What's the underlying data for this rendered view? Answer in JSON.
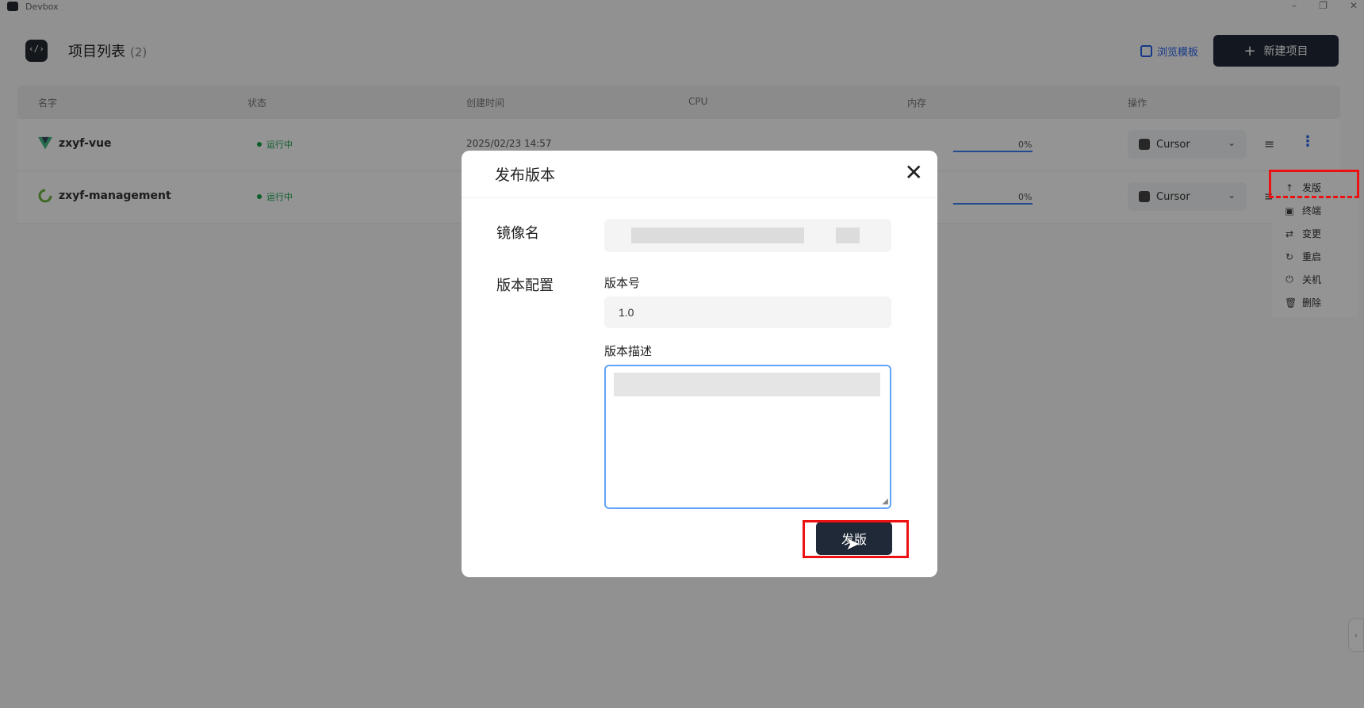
{
  "app": {
    "name": "Devbox"
  },
  "window_controls": [
    "–",
    "❐",
    "✕"
  ],
  "header": {
    "title": "项目列表",
    "count": "(2)",
    "template_link": "浏览模板",
    "new_button": "新建项目",
    "new_button_icon": "plus-icon"
  },
  "table": {
    "columns": [
      "名字",
      "状态",
      "创建时间",
      "CPU",
      "内存",
      "操作"
    ],
    "rows": [
      {
        "name": "zxyf-vue",
        "icon": "vue-icon",
        "status": "运行中",
        "created": "2025/02/23 14:57",
        "mem_pct": "0%",
        "ide": "Cursor"
      },
      {
        "name": "zxyf-management",
        "icon": "spring-icon",
        "status": "运行中",
        "created": "",
        "mem_pct": "0%",
        "ide": "Cursor"
      }
    ]
  },
  "dropdown": {
    "items": [
      {
        "label": "发版",
        "icon": "upload-icon"
      },
      {
        "label": "终端",
        "icon": "terminal-icon"
      },
      {
        "label": "变更",
        "icon": "swap-icon"
      },
      {
        "label": "重启",
        "icon": "restart-icon"
      },
      {
        "label": "关机",
        "icon": "power-icon"
      },
      {
        "label": "删除",
        "icon": "trash-icon"
      }
    ]
  },
  "modal": {
    "title": "发布版本",
    "close_icon": "close-icon",
    "image_name_label": "镜像名",
    "version_config_label": "版本配置",
    "version_number_label": "版本号",
    "version_number_value": "1.0",
    "version_desc_label": "版本描述",
    "submit_label": "发版"
  },
  "colors": {
    "accent": "#2563eb",
    "primary_button": "#1f2937",
    "running": "#16a34a",
    "highlight": "#ee1111"
  }
}
